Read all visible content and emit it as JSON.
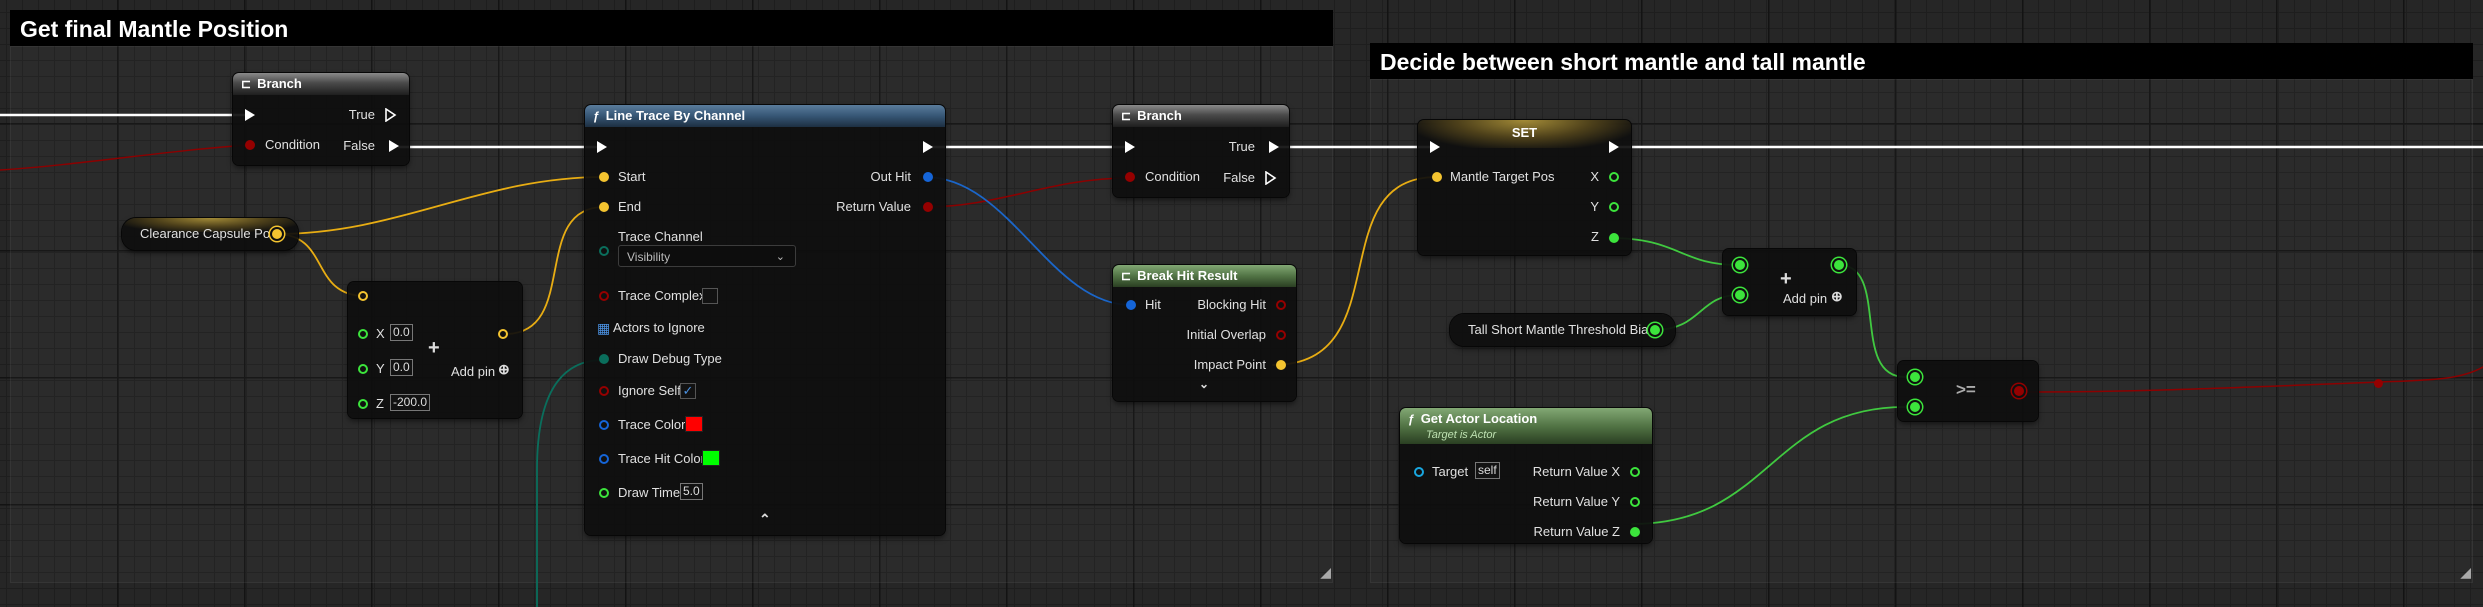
{
  "comments": {
    "left_title": "Get final Mantle Position",
    "right_title": "Decide between short mantle and tall mantle"
  },
  "branch1": {
    "title": "Branch",
    "true_label": "True",
    "false_label": "False",
    "condition_label": "Condition"
  },
  "clearance": {
    "label": "Clearance Capsule Pos"
  },
  "make_vector": {
    "x_label": "X",
    "x_value": "0.0",
    "y_label": "Y",
    "y_value": "0.0",
    "z_label": "Z",
    "z_value": "-200.0",
    "add_pin_label": "Add pin"
  },
  "line_trace": {
    "title": "Line Trace By Channel",
    "start_label": "Start",
    "end_label": "End",
    "trace_channel_label": "Trace Channel",
    "trace_channel_value": "Visibility",
    "trace_complex_label": "Trace Complex",
    "actors_to_ignore_label": "Actors to Ignore",
    "draw_debug_type_label": "Draw Debug Type",
    "ignore_self_label": "Ignore Self",
    "trace_color_label": "Trace Color",
    "trace_hit_color_label": "Trace Hit Color",
    "draw_time_label": "Draw Time",
    "draw_time_value": "5.0",
    "out_hit_label": "Out Hit",
    "return_value_label": "Return Value"
  },
  "branch2": {
    "title": "Branch",
    "true_label": "True",
    "false_label": "False",
    "condition_label": "Condition"
  },
  "break_hit": {
    "title": "Break Hit Result",
    "hit_label": "Hit",
    "blocking_hit_label": "Blocking Hit",
    "initial_overlap_label": "Initial Overlap",
    "impact_point_label": "Impact Point"
  },
  "set_node": {
    "title": "SET",
    "mantle_target_pos_label": "Mantle Target Pos",
    "x_label": "X",
    "y_label": "Y",
    "z_label": "Z"
  },
  "add_node": {
    "add_pin_label": "Add pin"
  },
  "threshold": {
    "label": "Tall Short Mantle Threshold Bias"
  },
  "compare": {
    "operator": ">="
  },
  "get_actor_location": {
    "title": "Get Actor Location",
    "subtitle": "Target is Actor",
    "target_label": "Target",
    "target_value": "self",
    "rv_x_label": "Return Value X",
    "rv_y_label": "Return Value Y",
    "rv_z_label": "Return Value Z"
  },
  "colors": {
    "exec": "#ffffff",
    "bool": "#950000",
    "vector": "#f4c430",
    "float": "#3ce43c",
    "struct": "#1565d8",
    "object": "#19a7e0",
    "enum": "#0a6e5c",
    "array": "#4a90e0"
  }
}
